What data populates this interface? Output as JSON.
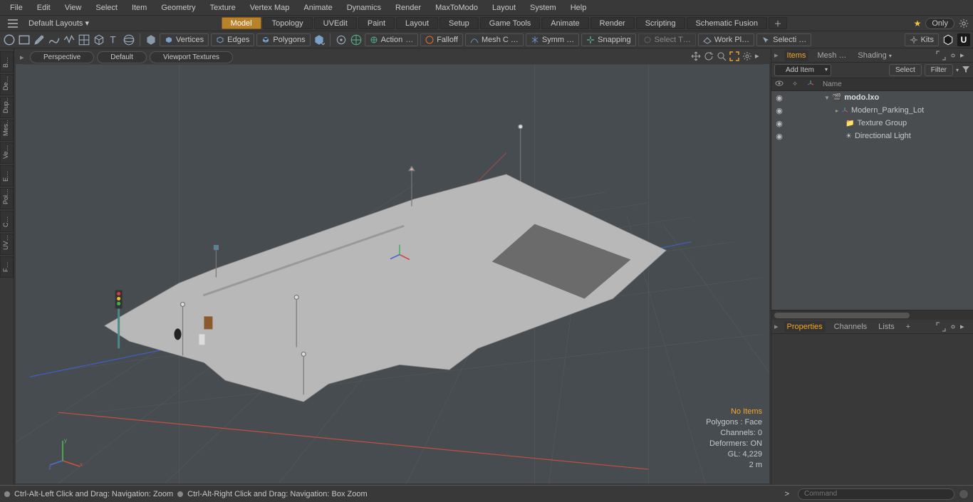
{
  "menu": {
    "items": [
      "File",
      "Edit",
      "View",
      "Select",
      "Item",
      "Geometry",
      "Texture",
      "Vertex Map",
      "Animate",
      "Dynamics",
      "Render",
      "MaxToModo",
      "Layout",
      "System",
      "Help"
    ]
  },
  "layoutbar": {
    "default_layouts": "Default Layouts ▾",
    "tabs": [
      "Model",
      "Topology",
      "UVEdit",
      "Paint",
      "Layout",
      "Setup",
      "Game Tools",
      "Animate",
      "Render",
      "Scripting",
      "Schematic Fusion"
    ],
    "active_tab": "Model",
    "only": "Only"
  },
  "toolbar": {
    "vertices": "Vertices",
    "edges": "Edges",
    "polygons": "Polygons",
    "action": "Action",
    "falloff": "Falloff",
    "mesh_c": "Mesh C …",
    "symm": "Symm …",
    "snapping": "Snapping",
    "select_t": "Select T…",
    "work_pl": "Work Pl…",
    "selecti": "Selecti …",
    "kits": "Kits"
  },
  "left_rail": [
    "B…",
    "De…",
    "Dup…",
    "Mes…",
    "Ve…",
    "E…",
    "Pol…",
    "C…",
    "UV…",
    "F…"
  ],
  "viewport": {
    "tabs": [
      "Perspective",
      "Default",
      "Viewport Textures"
    ],
    "overlay": {
      "no_items": "No Items",
      "polygons": "Polygons : Face",
      "channels": "Channels: 0",
      "deformers": "Deformers: ON",
      "gl": "GL: 4,229",
      "grid": "2 m"
    }
  },
  "right": {
    "tabs_top": [
      "Items",
      "Mesh …",
      "Shading"
    ],
    "active_top": "Items",
    "add_item": "Add Item",
    "select": "Select",
    "filter": "Filter",
    "header_name": "Name",
    "tree": {
      "root": "modo.lxo",
      "c1": "Modern_Parking_Lot",
      "c2": "Texture Group",
      "c3": "Directional Light"
    },
    "tabs_bottom": [
      "Properties",
      "Channels",
      "Lists"
    ],
    "active_bottom": "Properties"
  },
  "status": {
    "hint1": "Ctrl-Alt-Left Click and Drag: Navigation: Zoom",
    "hint2": "Ctrl-Alt-Right Click and Drag: Navigation: Box Zoom",
    "command_ph": "Command"
  }
}
